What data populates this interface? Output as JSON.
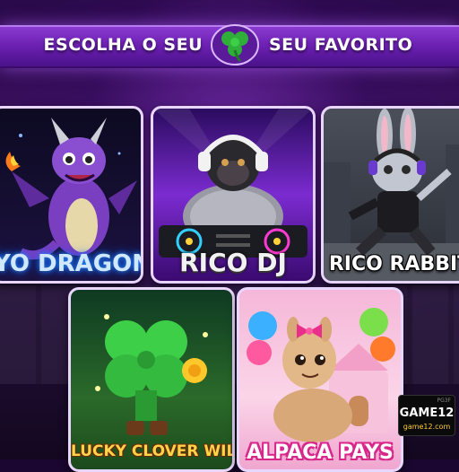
{
  "header": {
    "left_text": "ESCOLHA O SEU",
    "right_text": "SEU FAVORITO",
    "badge_icon": "clover-icon"
  },
  "games": [
    {
      "title": "YO DRAGON",
      "icon": "dragon-art"
    },
    {
      "title": "RICO DJ",
      "icon": "gorilla-dj-art"
    },
    {
      "title": "RICO RABBIT",
      "icon": "rabbit-art"
    },
    {
      "title": "LUCKY CLOVER WILD",
      "icon": "clover-art"
    },
    {
      "title": "ALPACA PAYS",
      "icon": "alpaca-art"
    }
  ],
  "logo": {
    "small": "PG3F",
    "name": "GAME12",
    "url": "game12.com"
  },
  "colors": {
    "banner": "#6a1fb0",
    "clover_green": "#2fae3a",
    "dragon_glow": "#2b8cff",
    "alpaca_pink": "#d8268a"
  }
}
